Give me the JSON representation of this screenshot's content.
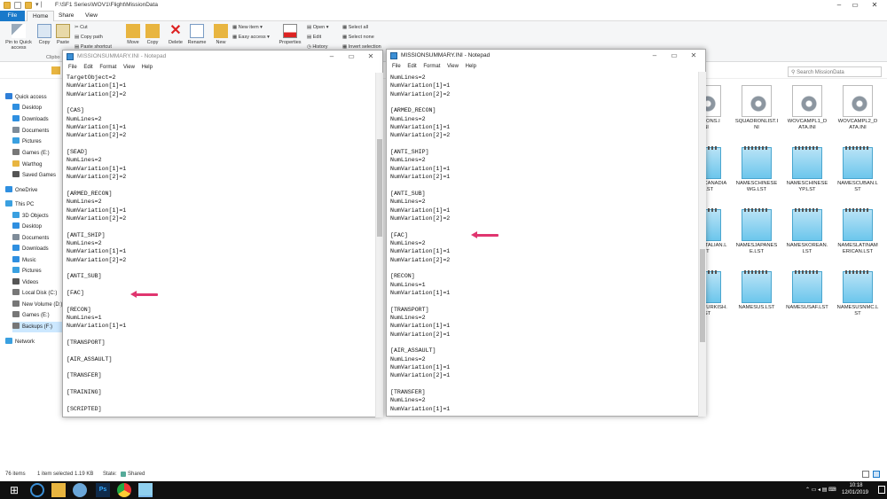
{
  "explorer": {
    "title_path": "F:\\SF1 Series\\WOV1\\Flight\\MissionData",
    "tabs": [
      "File",
      "Home",
      "Share",
      "View"
    ],
    "ribbon": {
      "pin_quick_access": "Pin to Quick access",
      "copy": "Copy",
      "paste": "Paste",
      "cut": "Cut",
      "copy_path": "Copy path",
      "paste_shortcut": "Paste shortcut",
      "clipboard_group": "Clipbo",
      "move_to": "Move",
      "copy_to": "Copy",
      "delete": "Delete",
      "rename": "Rename",
      "new_folder": "New",
      "new_item": "New item ▾",
      "easy_access": "Easy access ▾",
      "properties": "Properties",
      "open": "Open ▾",
      "edit": "Edit",
      "history": "History",
      "select_all": "Select all",
      "select_none": "Select none",
      "invert_selection": "Invert selection"
    },
    "search_placeholder": "Search MissionData",
    "nav": [
      {
        "label": "Quick access",
        "icon": "star-icon",
        "color": "#2f7fd8"
      },
      {
        "label": "Desktop",
        "icon": "desktop-icon",
        "color": "#2f8fe0"
      },
      {
        "label": "Downloads",
        "icon": "download-icon",
        "color": "#2f8fe0"
      },
      {
        "label": "Documents",
        "icon": "document-icon",
        "color": "#7f8c99"
      },
      {
        "label": "Pictures",
        "icon": "picture-icon",
        "color": "#3aa0e0"
      },
      {
        "label": "Games (E:)",
        "icon": "drive-icon",
        "color": "#777"
      },
      {
        "label": "Warthog",
        "icon": "folder-icon",
        "color": "#e8b540"
      },
      {
        "label": "Saved Games",
        "icon": "saved-games-icon",
        "color": "#555"
      },
      {
        "label": "OneDrive",
        "icon": "cloud-icon",
        "color": "#2f8fe0"
      },
      {
        "label": "This PC",
        "icon": "computer-icon",
        "color": "#3aa0e0"
      },
      {
        "label": "3D Objects",
        "icon": "cube-icon",
        "color": "#3aa0e0"
      },
      {
        "label": "Desktop",
        "icon": "desktop-icon",
        "color": "#2f8fe0"
      },
      {
        "label": "Documents",
        "icon": "document-icon",
        "color": "#7f8c99"
      },
      {
        "label": "Downloads",
        "icon": "download-icon",
        "color": "#2f8fe0"
      },
      {
        "label": "Music",
        "icon": "music-icon",
        "color": "#2f8fe0"
      },
      {
        "label": "Pictures",
        "icon": "picture-icon",
        "color": "#3aa0e0"
      },
      {
        "label": "Videos",
        "icon": "video-icon",
        "color": "#555"
      },
      {
        "label": "Local Disk (C:)",
        "icon": "drive-icon",
        "color": "#777"
      },
      {
        "label": "New Volume (D:)",
        "icon": "drive-icon",
        "color": "#777"
      },
      {
        "label": "Games (E:)",
        "icon": "drive-icon",
        "color": "#777"
      },
      {
        "label": "Backups (F:)",
        "icon": "drive-icon",
        "color": "#777"
      },
      {
        "label": "Network",
        "icon": "network-icon",
        "color": "#3aa0e0"
      }
    ],
    "files": [
      {
        "name": "MISSIONS.I\nNI",
        "type": "gear"
      },
      {
        "name": "SQUADRONLIST.I\nNI",
        "type": "gear"
      },
      {
        "name": "WOVCAMPL1_D\nATA.INI",
        "type": "gear"
      },
      {
        "name": "WOVCAMPL2_D\nATA.INI",
        "type": "gear"
      },
      {
        "name": "NAMESCANADIA\nN.LST",
        "type": "note"
      },
      {
        "name": "NAMESCHINESE\nWG.LST",
        "type": "note"
      },
      {
        "name": "NAMESCHINESE\nYP.LST",
        "type": "note"
      },
      {
        "name": "NAMESCUBAN.L\nST",
        "type": "note"
      },
      {
        "name": "NAMESITALIAN.L\nST",
        "type": "note"
      },
      {
        "name": "NAMESJAPANES\nE.LST",
        "type": "note"
      },
      {
        "name": "NAMESKOREAN.\nLST",
        "type": "note"
      },
      {
        "name": "NAMESLATINAM\nERICAN.LST",
        "type": "note"
      },
      {
        "name": "NAMESTURKISH.\nLST",
        "type": "note"
      },
      {
        "name": "NAMESUS.LST",
        "type": "note"
      },
      {
        "name": "NAMESUSAF.LST",
        "type": "note"
      },
      {
        "name": "NAMESUSNMC.L\nST",
        "type": "note"
      }
    ],
    "status": {
      "items": "76 items",
      "selected": "1 item selected  1.19 KB",
      "state": "State:",
      "state_value": "Shared"
    }
  },
  "notepad_left": {
    "title": "MISSIONSUMMARY.INI - Notepad",
    "menu": [
      "File",
      "Edit",
      "Format",
      "View",
      "Help"
    ],
    "text": "TargetObject=2\nNumVariation[1]=1\nNumVariation[2]=2\n\n[CAS]\nNumLines=2\nNumVariation[1]=1\nNumVariation[2]=2\n\n[SEAD]\nNumLines=2\nNumVariation[1]=1\nNumVariation[2]=2\n\n[ARMED_RECON]\nNumLines=2\nNumVariation[1]=1\nNumVariation[2]=2\n\n[ANTI_SHIP]\nNumLines=2\nNumVariation[1]=1\nNumVariation[2]=2\n\n[ANTI_SUB]\n\n[FAC]\n\n[RECON]\nNumLines=1\nNumVariation[1]=1\n\n[TRANSPORT]\n\n[AIR_ASSAULT]\n\n[TRANSFER]\n\n[TRAINING]\n\n[SCRIPTED]"
  },
  "notepad_right": {
    "title": "MISSIONSUMMARY.INI - Notepad",
    "menu": [
      "File",
      "Edit",
      "Format",
      "View",
      "Help"
    ],
    "text": "NumLines=2\nNumVariation[1]=1\nNumVariation[2]=2\n\n[ARMED_RECON]\nNumLines=2\nNumVariation[1]=1\nNumVariation[2]=2\n\n[ANTI_SHIP]\nNumLines=2\nNumVariation[1]=1\nNumVariation[2]=1\n\n[ANTI_SUB]\nNumLines=2\nNumVariation[1]=1\nNumVariation[2]=2\n\n[FAC]\nNumLines=2\nNumVariation[1]=1\nNumVariation[2]=2\n\n[RECON]\nNumLines=1\nNumVariation[1]=1\n\n[TRANSPORT]\nNumLines=2\nNumVariation[1]=1\nNumVariation[2]=1\n\n[AIR_ASSAULT]\nNumLines=2\nNumVariation[1]=1\nNumVariation[2]=1\n\n[TRANSFER]\nNumLines=2\nNumVariation[1]=1"
  },
  "taskbar": {
    "time": "10:18",
    "date": "12/01/2019"
  },
  "colors": {
    "accent": "#1979ca",
    "arrow": "#e0356f",
    "taskbar": "#101010"
  }
}
